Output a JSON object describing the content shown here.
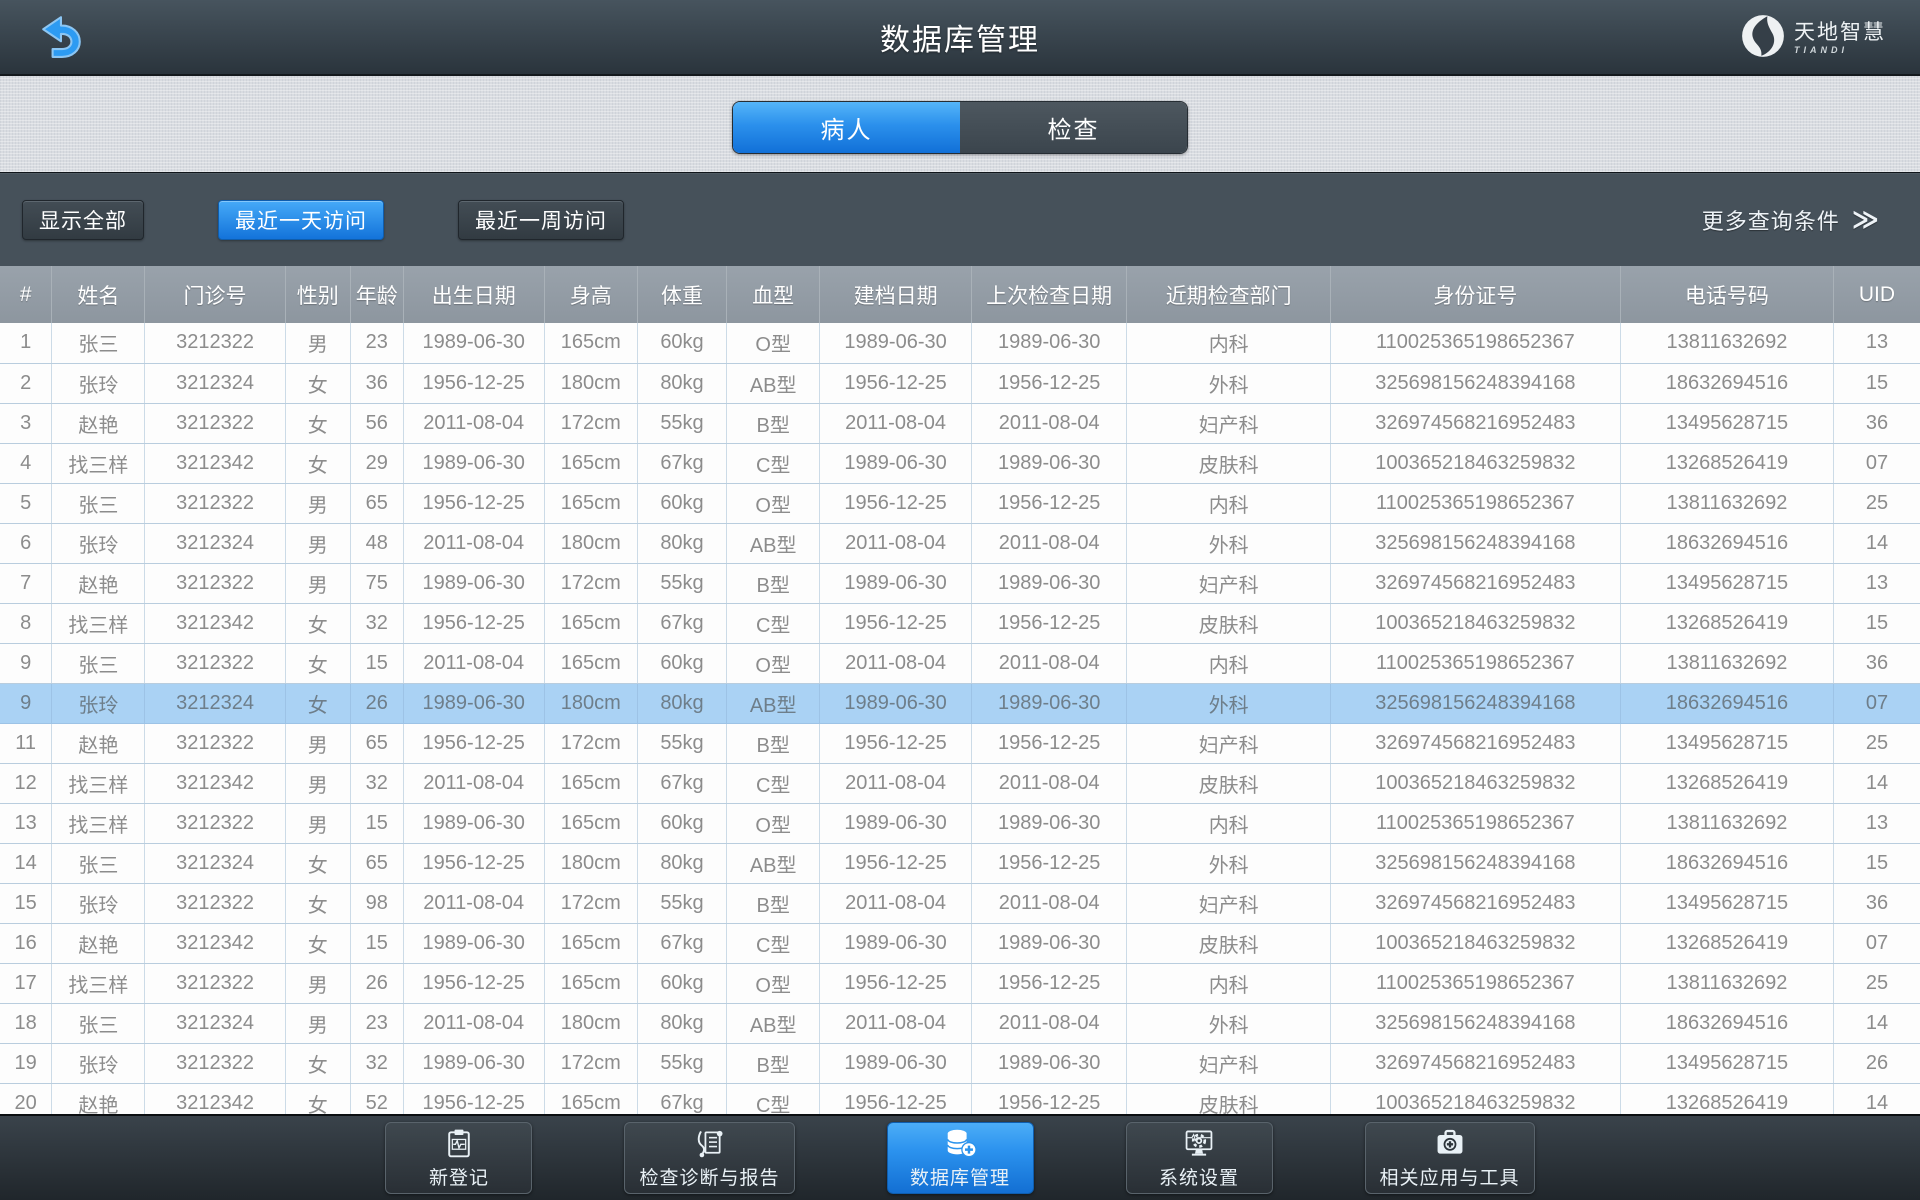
{
  "header": {
    "title": "数据库管理",
    "logo_name": "天地智慧",
    "logo_subtitle": "TIANDI"
  },
  "tabs": [
    {
      "label": "病人",
      "active": true
    },
    {
      "label": "检查",
      "active": false
    }
  ],
  "filters": {
    "buttons": [
      {
        "label": "显示全部",
        "active": false
      },
      {
        "label": "最近一天访问",
        "active": true
      },
      {
        "label": "最近一周访问",
        "active": false
      }
    ],
    "more_label": "更多查询条件",
    "more_icon": "double-chevron-right",
    "chevron_glyph": "≫"
  },
  "table": {
    "columns": [
      "#",
      "姓名",
      "门诊号",
      "性别",
      "年龄",
      "出生日期",
      "身高",
      "体重",
      "血型",
      "建档日期",
      "上次检查日期",
      "近期检查部门",
      "身份证号",
      "电话号码",
      "UID"
    ],
    "selected_index": 9,
    "rows": [
      [
        "1",
        "张三",
        "3212322",
        "男",
        "23",
        "1989-06-30",
        "165cm",
        "60kg",
        "O型",
        "1989-06-30",
        "1989-06-30",
        "内科",
        "110025365198652367",
        "13811632692",
        "13"
      ],
      [
        "2",
        "张玲",
        "3212324",
        "女",
        "36",
        "1956-12-25",
        "180cm",
        "80kg",
        "AB型",
        "1956-12-25",
        "1956-12-25",
        "外科",
        "325698156248394168",
        "18632694516",
        "15"
      ],
      [
        "3",
        "赵艳",
        "3212322",
        "女",
        "56",
        "2011-08-04",
        "172cm",
        "55kg",
        "B型",
        "2011-08-04",
        "2011-08-04",
        "妇产科",
        "326974568216952483",
        "13495628715",
        "36"
      ],
      [
        "4",
        "找三样",
        "3212342",
        "女",
        "29",
        "1989-06-30",
        "165cm",
        "67kg",
        "C型",
        "1989-06-30",
        "1989-06-30",
        "皮肤科",
        "100365218463259832",
        "13268526419",
        "07"
      ],
      [
        "5",
        "张三",
        "3212322",
        "男",
        "65",
        "1956-12-25",
        "165cm",
        "60kg",
        "O型",
        "1956-12-25",
        "1956-12-25",
        "内科",
        "110025365198652367",
        "13811632692",
        "25"
      ],
      [
        "6",
        "张玲",
        "3212324",
        "男",
        "48",
        "2011-08-04",
        "180cm",
        "80kg",
        "AB型",
        "2011-08-04",
        "2011-08-04",
        "外科",
        "325698156248394168",
        "18632694516",
        "14"
      ],
      [
        "7",
        "赵艳",
        "3212322",
        "男",
        "75",
        "1989-06-30",
        "172cm",
        "55kg",
        "B型",
        "1989-06-30",
        "1989-06-30",
        "妇产科",
        "326974568216952483",
        "13495628715",
        "13"
      ],
      [
        "8",
        "找三样",
        "3212342",
        "女",
        "32",
        "1956-12-25",
        "165cm",
        "67kg",
        "C型",
        "1956-12-25",
        "1956-12-25",
        "皮肤科",
        "100365218463259832",
        "13268526419",
        "15"
      ],
      [
        "9",
        "张三",
        "3212322",
        "女",
        "15",
        "2011-08-04",
        "165cm",
        "60kg",
        "O型",
        "2011-08-04",
        "2011-08-04",
        "内科",
        "110025365198652367",
        "13811632692",
        "36"
      ],
      [
        "9",
        "张玲",
        "3212324",
        "女",
        "26",
        "1989-06-30",
        "180cm",
        "80kg",
        "AB型",
        "1989-06-30",
        "1989-06-30",
        "外科",
        "325698156248394168",
        "18632694516",
        "07"
      ],
      [
        "11",
        "赵艳",
        "3212322",
        "男",
        "65",
        "1956-12-25",
        "172cm",
        "55kg",
        "B型",
        "1956-12-25",
        "1956-12-25",
        "妇产科",
        "326974568216952483",
        "13495628715",
        "25"
      ],
      [
        "12",
        "找三样",
        "3212342",
        "男",
        "32",
        "2011-08-04",
        "165cm",
        "67kg",
        "C型",
        "2011-08-04",
        "2011-08-04",
        "皮肤科",
        "100365218463259832",
        "13268526419",
        "14"
      ],
      [
        "13",
        "找三样",
        "3212322",
        "男",
        "15",
        "1989-06-30",
        "165cm",
        "60kg",
        "O型",
        "1989-06-30",
        "1989-06-30",
        "内科",
        "110025365198652367",
        "13811632692",
        "13"
      ],
      [
        "14",
        "张三",
        "3212324",
        "女",
        "65",
        "1956-12-25",
        "180cm",
        "80kg",
        "AB型",
        "1956-12-25",
        "1956-12-25",
        "外科",
        "325698156248394168",
        "18632694516",
        "15"
      ],
      [
        "15",
        "张玲",
        "3212322",
        "女",
        "98",
        "2011-08-04",
        "172cm",
        "55kg",
        "B型",
        "2011-08-04",
        "2011-08-04",
        "妇产科",
        "326974568216952483",
        "13495628715",
        "36"
      ],
      [
        "16",
        "赵艳",
        "3212342",
        "女",
        "15",
        "1989-06-30",
        "165cm",
        "67kg",
        "C型",
        "1989-06-30",
        "1989-06-30",
        "皮肤科",
        "100365218463259832",
        "13268526419",
        "07"
      ],
      [
        "17",
        "找三样",
        "3212322",
        "男",
        "26",
        "1956-12-25",
        "165cm",
        "60kg",
        "O型",
        "1956-12-25",
        "1956-12-25",
        "内科",
        "110025365198652367",
        "13811632692",
        "25"
      ],
      [
        "18",
        "张三",
        "3212324",
        "男",
        "23",
        "2011-08-04",
        "180cm",
        "80kg",
        "AB型",
        "2011-08-04",
        "2011-08-04",
        "外科",
        "325698156248394168",
        "18632694516",
        "14"
      ],
      [
        "19",
        "张玲",
        "3212322",
        "女",
        "32",
        "1989-06-30",
        "172cm",
        "55kg",
        "B型",
        "1989-06-30",
        "1989-06-30",
        "妇产科",
        "326974568216952483",
        "13495628715",
        "26"
      ],
      [
        "20",
        "赵艳",
        "3212342",
        "女",
        "52",
        "1956-12-25",
        "165cm",
        "67kg",
        "C型",
        "1956-12-25",
        "1956-12-25",
        "皮肤科",
        "100365218463259832",
        "13268526419",
        "14"
      ]
    ]
  },
  "bottom_nav": {
    "items": [
      {
        "label": "新登记",
        "icon": "clipboard-waveform-icon",
        "active": false
      },
      {
        "label": "检查诊断与报告",
        "icon": "stethoscope-report-icon",
        "active": false
      },
      {
        "label": "数据库管理",
        "icon": "database-cross-icon",
        "active": true
      },
      {
        "label": "系统设置",
        "icon": "monitor-gear-icon",
        "active": false
      },
      {
        "label": "相关应用与工具",
        "icon": "toolbox-plus-icon",
        "active": false
      }
    ]
  },
  "colors": {
    "accent_blue": "#2b90ec",
    "header_dark": "#3a444d",
    "filter_bar": "#46515a",
    "table_header": "#929ba4",
    "row_highlight": "#aad2f4",
    "row_text": "#8c8c8c"
  }
}
